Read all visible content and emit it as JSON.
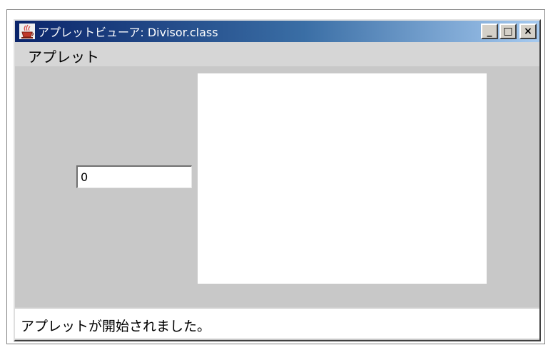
{
  "window": {
    "title": "アプレットビューア: Divisor.class",
    "icon": "java-cup-icon",
    "controls": {
      "minimize": "_",
      "maximize": "□",
      "close": "×"
    }
  },
  "menubar": {
    "items": [
      {
        "label": "アプレット"
      }
    ]
  },
  "applet": {
    "input_value": "0"
  },
  "status": {
    "text": "アプレットが開始されました。"
  },
  "colors": {
    "titlebar_start": "#0a246a",
    "titlebar_end": "#a6caf0",
    "window_bg": "#c8c8c8",
    "canvas_bg": "#ffffff"
  }
}
